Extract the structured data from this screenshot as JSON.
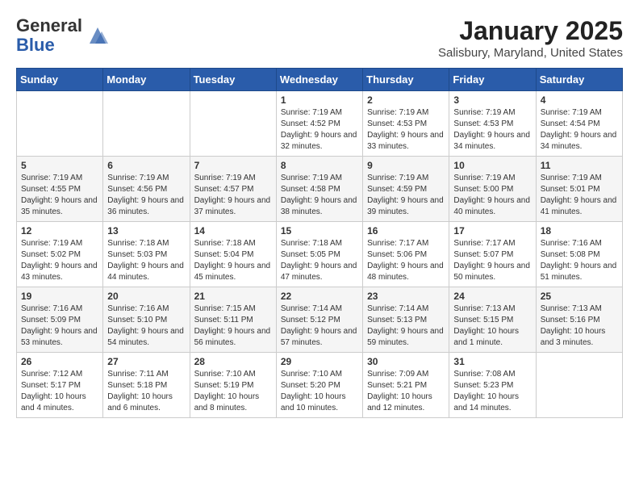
{
  "header": {
    "logo_general": "General",
    "logo_blue": "Blue",
    "month": "January 2025",
    "location": "Salisbury, Maryland, United States"
  },
  "days_of_week": [
    "Sunday",
    "Monday",
    "Tuesday",
    "Wednesday",
    "Thursday",
    "Friday",
    "Saturday"
  ],
  "weeks": [
    [
      {
        "day": "",
        "info": ""
      },
      {
        "day": "",
        "info": ""
      },
      {
        "day": "",
        "info": ""
      },
      {
        "day": "1",
        "info": "Sunrise: 7:19 AM\nSunset: 4:52 PM\nDaylight: 9 hours and 32 minutes."
      },
      {
        "day": "2",
        "info": "Sunrise: 7:19 AM\nSunset: 4:53 PM\nDaylight: 9 hours and 33 minutes."
      },
      {
        "day": "3",
        "info": "Sunrise: 7:19 AM\nSunset: 4:53 PM\nDaylight: 9 hours and 34 minutes."
      },
      {
        "day": "4",
        "info": "Sunrise: 7:19 AM\nSunset: 4:54 PM\nDaylight: 9 hours and 34 minutes."
      }
    ],
    [
      {
        "day": "5",
        "info": "Sunrise: 7:19 AM\nSunset: 4:55 PM\nDaylight: 9 hours and 35 minutes."
      },
      {
        "day": "6",
        "info": "Sunrise: 7:19 AM\nSunset: 4:56 PM\nDaylight: 9 hours and 36 minutes."
      },
      {
        "day": "7",
        "info": "Sunrise: 7:19 AM\nSunset: 4:57 PM\nDaylight: 9 hours and 37 minutes."
      },
      {
        "day": "8",
        "info": "Sunrise: 7:19 AM\nSunset: 4:58 PM\nDaylight: 9 hours and 38 minutes."
      },
      {
        "day": "9",
        "info": "Sunrise: 7:19 AM\nSunset: 4:59 PM\nDaylight: 9 hours and 39 minutes."
      },
      {
        "day": "10",
        "info": "Sunrise: 7:19 AM\nSunset: 5:00 PM\nDaylight: 9 hours and 40 minutes."
      },
      {
        "day": "11",
        "info": "Sunrise: 7:19 AM\nSunset: 5:01 PM\nDaylight: 9 hours and 41 minutes."
      }
    ],
    [
      {
        "day": "12",
        "info": "Sunrise: 7:19 AM\nSunset: 5:02 PM\nDaylight: 9 hours and 43 minutes."
      },
      {
        "day": "13",
        "info": "Sunrise: 7:18 AM\nSunset: 5:03 PM\nDaylight: 9 hours and 44 minutes."
      },
      {
        "day": "14",
        "info": "Sunrise: 7:18 AM\nSunset: 5:04 PM\nDaylight: 9 hours and 45 minutes."
      },
      {
        "day": "15",
        "info": "Sunrise: 7:18 AM\nSunset: 5:05 PM\nDaylight: 9 hours and 47 minutes."
      },
      {
        "day": "16",
        "info": "Sunrise: 7:17 AM\nSunset: 5:06 PM\nDaylight: 9 hours and 48 minutes."
      },
      {
        "day": "17",
        "info": "Sunrise: 7:17 AM\nSunset: 5:07 PM\nDaylight: 9 hours and 50 minutes."
      },
      {
        "day": "18",
        "info": "Sunrise: 7:16 AM\nSunset: 5:08 PM\nDaylight: 9 hours and 51 minutes."
      }
    ],
    [
      {
        "day": "19",
        "info": "Sunrise: 7:16 AM\nSunset: 5:09 PM\nDaylight: 9 hours and 53 minutes."
      },
      {
        "day": "20",
        "info": "Sunrise: 7:16 AM\nSunset: 5:10 PM\nDaylight: 9 hours and 54 minutes."
      },
      {
        "day": "21",
        "info": "Sunrise: 7:15 AM\nSunset: 5:11 PM\nDaylight: 9 hours and 56 minutes."
      },
      {
        "day": "22",
        "info": "Sunrise: 7:14 AM\nSunset: 5:12 PM\nDaylight: 9 hours and 57 minutes."
      },
      {
        "day": "23",
        "info": "Sunrise: 7:14 AM\nSunset: 5:13 PM\nDaylight: 9 hours and 59 minutes."
      },
      {
        "day": "24",
        "info": "Sunrise: 7:13 AM\nSunset: 5:15 PM\nDaylight: 10 hours and 1 minute."
      },
      {
        "day": "25",
        "info": "Sunrise: 7:13 AM\nSunset: 5:16 PM\nDaylight: 10 hours and 3 minutes."
      }
    ],
    [
      {
        "day": "26",
        "info": "Sunrise: 7:12 AM\nSunset: 5:17 PM\nDaylight: 10 hours and 4 minutes."
      },
      {
        "day": "27",
        "info": "Sunrise: 7:11 AM\nSunset: 5:18 PM\nDaylight: 10 hours and 6 minutes."
      },
      {
        "day": "28",
        "info": "Sunrise: 7:10 AM\nSunset: 5:19 PM\nDaylight: 10 hours and 8 minutes."
      },
      {
        "day": "29",
        "info": "Sunrise: 7:10 AM\nSunset: 5:20 PM\nDaylight: 10 hours and 10 minutes."
      },
      {
        "day": "30",
        "info": "Sunrise: 7:09 AM\nSunset: 5:21 PM\nDaylight: 10 hours and 12 minutes."
      },
      {
        "day": "31",
        "info": "Sunrise: 7:08 AM\nSunset: 5:23 PM\nDaylight: 10 hours and 14 minutes."
      },
      {
        "day": "",
        "info": ""
      }
    ]
  ]
}
